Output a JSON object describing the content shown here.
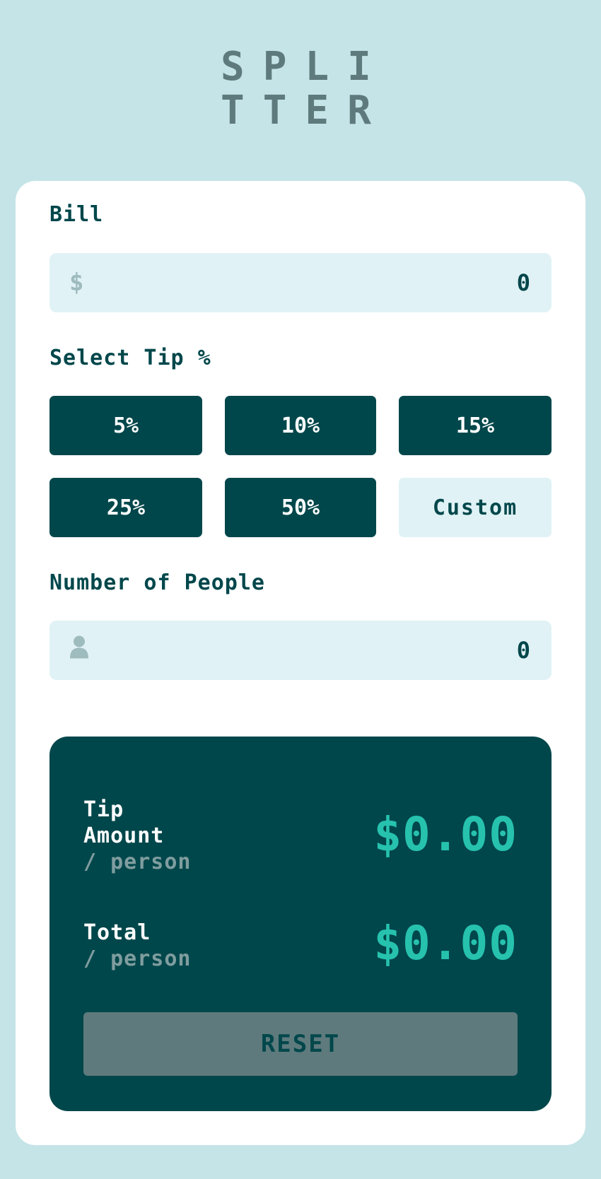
{
  "logo": {
    "line1": "SPLI",
    "line2": "TTER"
  },
  "bill": {
    "label": "Bill",
    "currency_icon": "dollar-icon",
    "currency_symbol": "$",
    "value": "0"
  },
  "tip": {
    "label": "Select Tip %",
    "options": [
      {
        "label": "5%"
      },
      {
        "label": "10%"
      },
      {
        "label": "15%"
      },
      {
        "label": "25%"
      },
      {
        "label": "50%"
      },
      {
        "label": "Custom"
      }
    ]
  },
  "people": {
    "label": "Number of People",
    "icon": "person-icon",
    "value": "0"
  },
  "results": {
    "tip_amount": {
      "label_line1": "Tip",
      "label_line2": "Amount",
      "sub": "/ person",
      "value": "$0.00"
    },
    "total": {
      "label": "Total",
      "sub": "/ person",
      "value": "$0.00"
    },
    "reset_label": "RESET"
  },
  "colors": {
    "background": "#c5e4e7",
    "primary": "#00474b",
    "accent": "#26c2ae",
    "input_bg": "#e0f2f5",
    "muted": "#5e7a7d"
  }
}
